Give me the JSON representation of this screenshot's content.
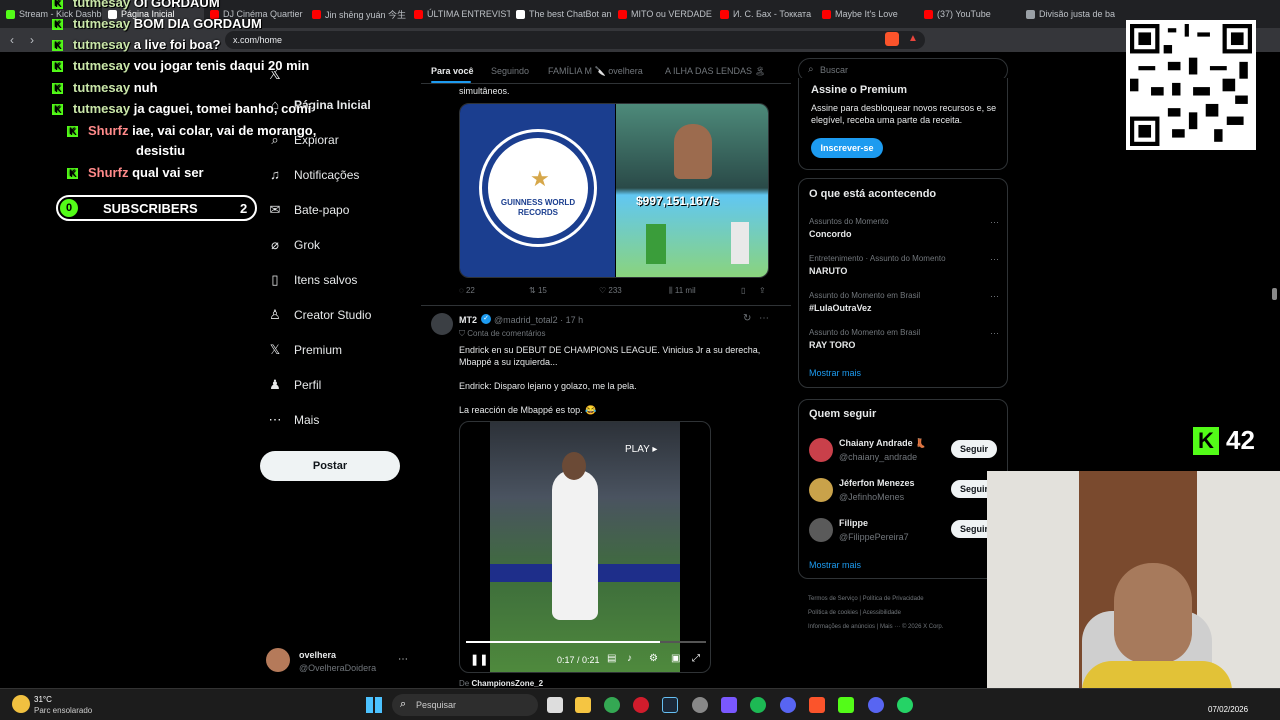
{
  "browser": {
    "tabs": [
      {
        "label": "Stream - Kick Dashb",
        "color": "#53fc18"
      },
      {
        "label": "Página Inicial",
        "color": "#ffffff"
      },
      {
        "label": "DJ Cinéma Quartier",
        "color": "#ff0000"
      },
      {
        "label": "Jin shēng yuán 今生",
        "color": "#ff0000"
      },
      {
        "label": "ÚLTIMA ENTREVISTA",
        "color": "#ff0000"
      },
      {
        "label": "The best ChatBot an",
        "color": "#ffffff"
      },
      {
        "label": "MITO ou VERDADE",
        "color": "#ff0000"
      },
      {
        "label": "И. С. Бах - Токката",
        "color": "#ff0000"
      },
      {
        "label": "Maybe It's Love",
        "color": "#ff0000"
      },
      {
        "label": "(37) YouTube",
        "color": "#ff0000"
      },
      {
        "label": "Divisão justa de ba",
        "color": "#9aa0a6"
      }
    ],
    "url": "x.com/home"
  },
  "chat": [
    {
      "user": "tutmesay",
      "text": "Oi GORDAUM"
    },
    {
      "user": "tutmesay",
      "text": "BOM DIA GORDAUM"
    },
    {
      "user": "tutmesay",
      "text": "a live foi boa?"
    },
    {
      "user": "tutmesay",
      "text": "vou jogar tenis daqui 20 min"
    },
    {
      "user": "tutmesay",
      "text": "nuh"
    },
    {
      "user": "tutmesay",
      "text": "ja caguei, tomei banho, comi"
    },
    {
      "user": "Shurfz",
      "text": "iae, vai colar, vai de morango,"
    },
    {
      "user": "",
      "text": "desistiu"
    },
    {
      "user": "Shurfz",
      "text": "qual vai ser"
    }
  ],
  "subscribers": {
    "left": "0",
    "label": "SUBSCRIBERS",
    "right": "2"
  },
  "kick_counter": "42",
  "sidebar": {
    "items": [
      {
        "label": "Página Inicial",
        "icon": "home-icon",
        "glyph": "⌂"
      },
      {
        "label": "Explorar",
        "icon": "search-icon",
        "glyph": "⌕"
      },
      {
        "label": "Notificações",
        "icon": "bell-icon",
        "glyph": "🔔"
      },
      {
        "label": "Bate-papo",
        "icon": "mail-icon",
        "glyph": "✉"
      },
      {
        "label": "Grok",
        "icon": "grok-icon",
        "glyph": "⌀"
      },
      {
        "label": "Itens salvos",
        "icon": "bookmark-icon",
        "glyph": "▯"
      },
      {
        "label": "Creator Studio",
        "icon": "creator-icon",
        "glyph": "♙"
      },
      {
        "label": "Premium",
        "icon": "x-logo-icon",
        "glyph": "𝕏"
      },
      {
        "label": "Perfil",
        "icon": "profile-icon",
        "glyph": "♟"
      },
      {
        "label": "Mais",
        "icon": "more-icon",
        "glyph": "⋯"
      }
    ],
    "post_button": "Postar",
    "account_name": "ovelhera",
    "account_handle": "@OvelheraDoidera"
  },
  "feed": {
    "tabs": [
      "Para você",
      "Seguindo",
      "FAMÍLIA M 🔪 ovelhera",
      "A ILHA DAS LENDAS 🏝"
    ],
    "prev_post_tail": "simultâneos.",
    "image_text": {
      "guinness": "GUINNESS WORLD RECORDS",
      "money": "$997,151,167/s"
    },
    "prev_post_stats": {
      "replies": "22",
      "reposts": "15",
      "likes": "233",
      "views": "11 mil"
    },
    "post": {
      "name": "MT2",
      "handle": "@madrid_total2 · 17 h",
      "community": "Conta de comentários",
      "line1": "Endrick en su DEBUT DE CHAMPIONS LEAGUE. Vinicius Jr a su derecha,",
      "line2": "Mbappé a su izquierda...",
      "line3": "Endrick: Disparo lejano y golazo, me la pela.",
      "line4": "La reacción de Mbappé es top. 😂",
      "video_play": "PLAY ▸",
      "video_time": "0:17 / 0:21",
      "from_label": "De",
      "from_account": "ChampionsZone_2"
    }
  },
  "right": {
    "search_placeholder": "Buscar",
    "premium": {
      "title": "Assine o Premium",
      "text": "Assine para desbloquear novos recursos e, se elegível, receba uma parte da receita.",
      "button": "Inscrever-se"
    },
    "trends_title": "O que está acontecendo",
    "trends": [
      {
        "sub": "Assuntos do Momento",
        "title": "Concordo"
      },
      {
        "sub": "Entretenimento · Assunto do Momento",
        "title": "NARUTO"
      },
      {
        "sub": "Assunto do Momento em Brasil",
        "title": "#LulaOutraVez"
      },
      {
        "sub": "Assunto do Momento em Brasil",
        "title": "RAY TORO"
      }
    ],
    "trends_more": "Mostrar mais",
    "follow_title": "Quem seguir",
    "follow": [
      {
        "name": "Chaiany Andrade 👢",
        "handle": "@chaiany_andrade"
      },
      {
        "name": "Jéferfon Menezes",
        "handle": "@JefinhoMenes"
      },
      {
        "name": "Filippe",
        "handle": "@FilippePereira7"
      }
    ],
    "follow_button": "Seguir",
    "follow_more": "Mostrar mais",
    "footer": [
      "Termos de Serviço",
      "Política de Privacidade",
      "Política de cookies",
      "Acessibilidade",
      "Informações de anúncios",
      "Mais ···",
      "© 2026 X Corp."
    ]
  },
  "taskbar": {
    "temp": "31°C",
    "weather": "Parc ensolarado",
    "search": "Pesquisar",
    "time": "07/02/2026"
  }
}
